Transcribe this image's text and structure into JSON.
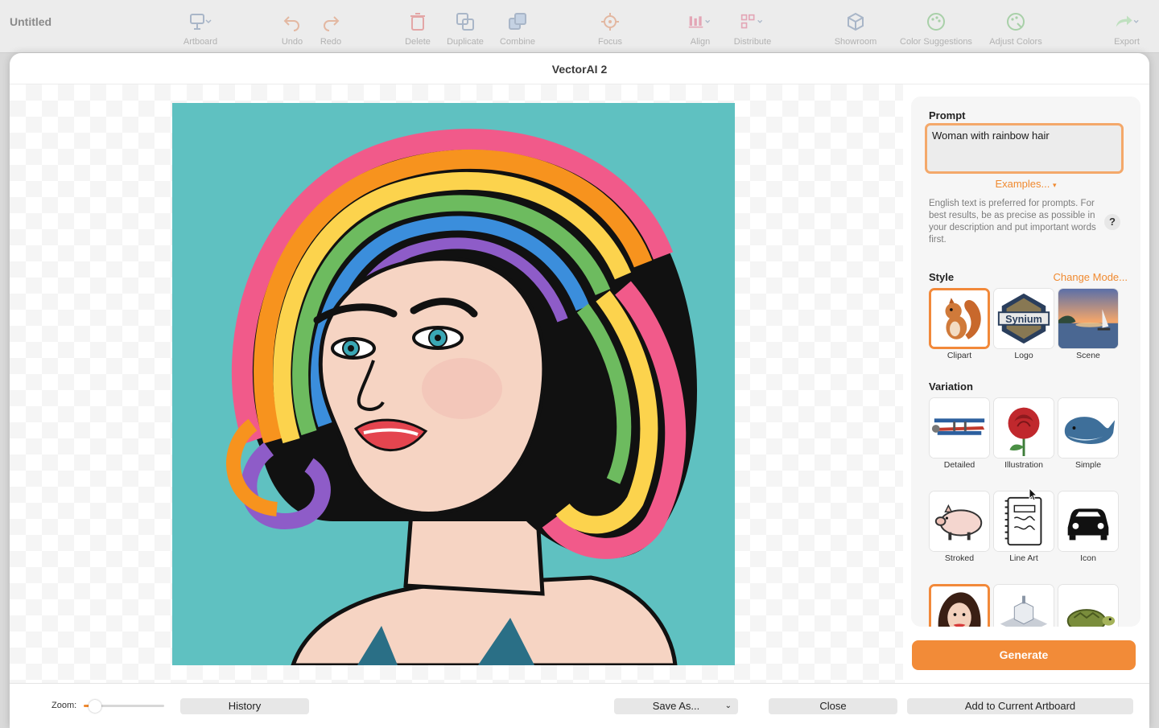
{
  "app": {
    "title": "Untitled",
    "toolbar": [
      {
        "label": "Artboard",
        "icon": "artboard-icon"
      },
      {
        "label": "Undo",
        "icon": "undo-icon"
      },
      {
        "label": "Redo",
        "icon": "redo-icon"
      },
      {
        "label": "Delete",
        "icon": "trash-icon"
      },
      {
        "label": "Duplicate",
        "icon": "duplicate-icon"
      },
      {
        "label": "Combine",
        "icon": "combine-icon"
      },
      {
        "label": "Focus",
        "icon": "focus-icon"
      },
      {
        "label": "Align",
        "icon": "align-icon"
      },
      {
        "label": "Distribute",
        "icon": "distribute-icon"
      },
      {
        "label": "Showroom",
        "icon": "cube-icon"
      },
      {
        "label": "Color Suggestions",
        "icon": "palette-icon"
      },
      {
        "label": "Adjust Colors",
        "icon": "palette-adjust-icon"
      },
      {
        "label": "Export",
        "icon": "share-icon"
      }
    ]
  },
  "dialog": {
    "title": "VectorAI 2",
    "prompt": {
      "heading": "Prompt",
      "value": "Woman with rainbow hair",
      "examples_label": "Examples...",
      "hint": "English text is preferred for prompts. For best results, be as precise as possible in your description and put important words first.",
      "help_label": "?"
    },
    "style": {
      "heading": "Style",
      "change_mode": "Change Mode...",
      "options": [
        {
          "label": "Clipart",
          "icon": "squirrel-thumbnail",
          "selected": true
        },
        {
          "label": "Logo",
          "icon": "synium-logo-thumbnail",
          "selected": false
        },
        {
          "label": "Scene",
          "icon": "lake-sunset-thumbnail",
          "selected": false
        }
      ]
    },
    "variation": {
      "heading": "Variation",
      "options": [
        {
          "label": "Detailed",
          "icon": "biplane-thumbnail",
          "selected": false
        },
        {
          "label": "Illustration",
          "icon": "rose-thumbnail",
          "selected": false
        },
        {
          "label": "Simple",
          "icon": "whale-thumbnail",
          "selected": false
        },
        {
          "label": "Stroked",
          "icon": "pig-thumbnail",
          "selected": false
        },
        {
          "label": "Line Art",
          "icon": "journal-thumbnail",
          "selected": false
        },
        {
          "label": "Icon",
          "icon": "car-thumbnail",
          "selected": false
        },
        {
          "label": "",
          "icon": "pinup-woman-thumbnail",
          "selected": true
        },
        {
          "label": "",
          "icon": "isometric-building-thumbnail",
          "selected": false
        },
        {
          "label": "",
          "icon": "turtle-thumbnail",
          "selected": false
        }
      ]
    },
    "generate_label": "Generate",
    "zoom_label": "Zoom:",
    "zoom_level": 0.14,
    "history_label": "History",
    "save_as_label": "Save As...",
    "close_label": "Close",
    "add_label": "Add to Current Artboard"
  },
  "colors": {
    "accent": "#f28b38",
    "artwork_background": "#5fc1c1"
  }
}
